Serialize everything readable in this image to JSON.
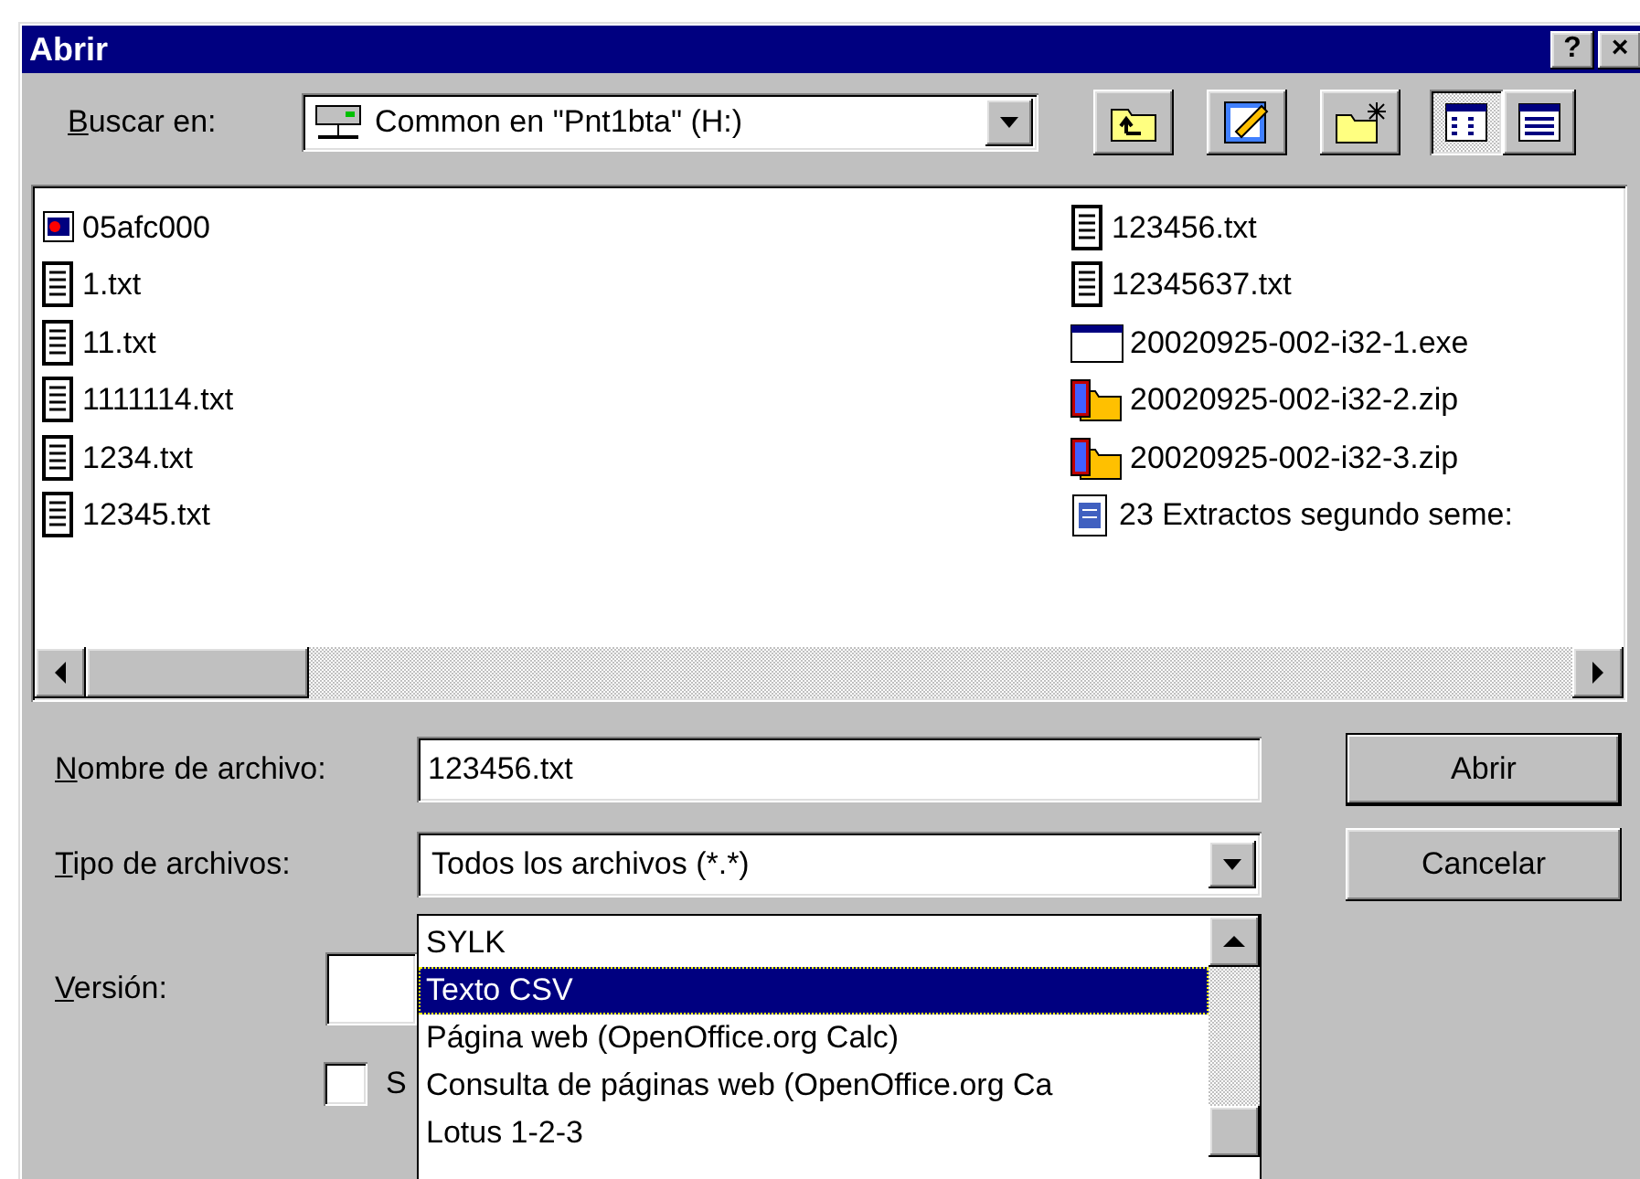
{
  "window": {
    "title": "Abrir",
    "buttons": [
      "?",
      "×"
    ]
  },
  "look_in": {
    "label": "Buscar en:",
    "value": "Common en \"Pnt1bta\" (H:)"
  },
  "view_modes": [
    {
      "selected": true
    },
    {
      "selected": false
    }
  ],
  "files": [
    {
      "name": "05afc000",
      "kind": "image"
    },
    {
      "name": "1.txt",
      "kind": "text"
    },
    {
      "name": "11.txt",
      "kind": "text"
    },
    {
      "name": "1111114.txt",
      "kind": "text"
    },
    {
      "name": "1234.txt",
      "kind": "text"
    },
    {
      "name": "12345.txt",
      "kind": "text"
    },
    {
      "name": "123456.txt",
      "kind": "text"
    },
    {
      "name": "12345637.txt",
      "kind": "text"
    },
    {
      "name": "20020925-002-i32-1.exe",
      "kind": "program"
    },
    {
      "name": "20020925-002-i32-2.zip",
      "kind": "archive"
    },
    {
      "name": "20020925-002-i32-3.zip",
      "kind": "archive"
    },
    {
      "name": "23 Extractos segundo seme:",
      "kind": "document"
    }
  ],
  "file_name": {
    "label": "Nombre de archivo:",
    "value": "123456.txt"
  },
  "file_type": {
    "label": "Tipo de archivos:",
    "value": "Todos los archivos (*.*)",
    "options": [
      {
        "label": "SYLK",
        "selected": false
      },
      {
        "label": "Texto CSV",
        "selected": true
      },
      {
        "label": "Página web (OpenOffice.org Calc)",
        "selected": false
      },
      {
        "label": "Consulta de páginas web (OpenOffice.org Ca",
        "selected": false
      },
      {
        "label": "Lotus 1-2-3",
        "selected": false
      }
    ]
  },
  "version": {
    "label": "Versión:"
  },
  "option": {
    "label": "S",
    "checked": false
  },
  "buttons": [
    "Abrir",
    "Cancelar"
  ]
}
